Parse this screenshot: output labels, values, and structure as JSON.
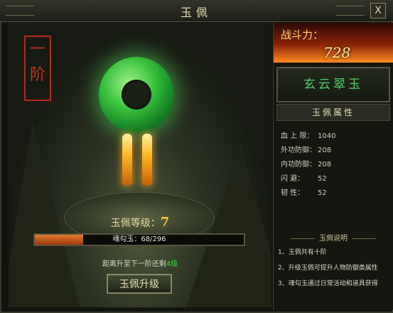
{
  "window": {
    "title": "玉佩",
    "close_label": "X"
  },
  "left": {
    "stage_badge": "一阶",
    "level_label": "玉佩等级：",
    "level_value": "7",
    "progress": {
      "text": "魂勾玉：68/296",
      "current": 68,
      "max": 296
    },
    "hint_prefix": "距离升至下一阶还剩",
    "hint_highlight": "4级",
    "upgrade_button": "玉佩升级"
  },
  "right": {
    "power_label": "战斗力：",
    "power_value": "728",
    "item_name": "玄云翠玉",
    "attributes_title": "玉佩属性",
    "stats": [
      {
        "label": "血 上 限：",
        "value": "1040"
      },
      {
        "label": "外功防御：",
        "value": "208"
      },
      {
        "label": "内功防御：",
        "value": "208"
      },
      {
        "label": "闪     避：",
        "value": "52"
      },
      {
        "label": "韧     性：",
        "value": "52"
      }
    ],
    "desc_title": "玉佩说明",
    "desc": [
      "1、玉佩共有十阶",
      "2、升级玉佩可提升人物防御类属性",
      "3、魂勾玉通过日常活动和道具获得"
    ]
  },
  "colors": {
    "jade": "#39c23c",
    "tassel": "#ffb21e",
    "progress_fill": "#e07b2e",
    "hint_highlight": "#33dd33"
  }
}
